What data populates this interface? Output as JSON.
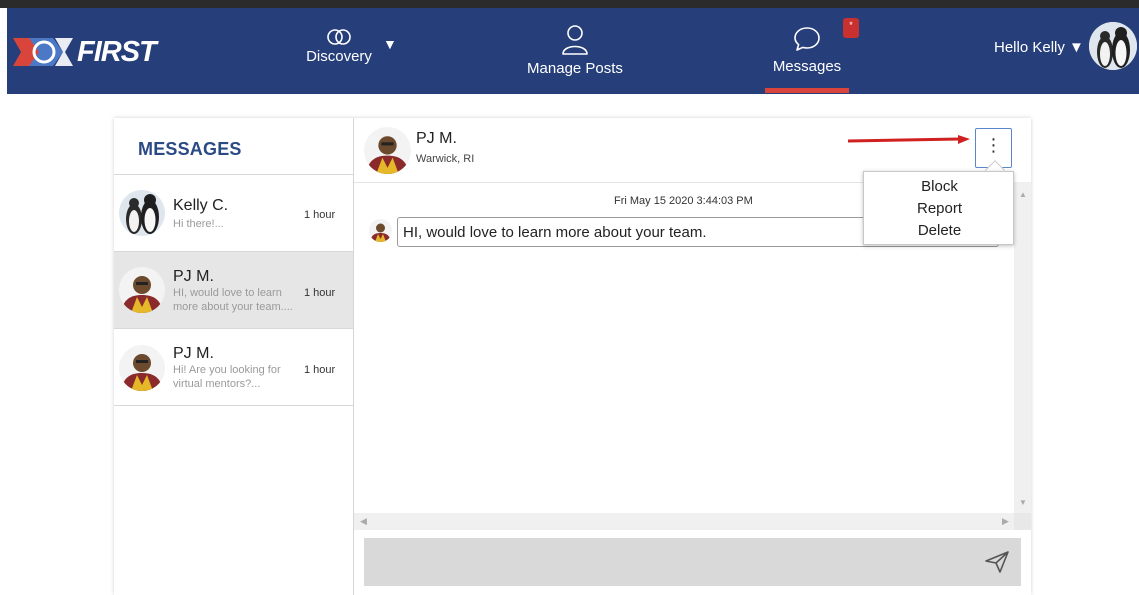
{
  "nav": {
    "logo_text": "FIRST",
    "discovery": "Discovery",
    "manage_posts": "Manage Posts",
    "messages": "Messages",
    "messages_badge": "*",
    "greeting": "Hello Kelly",
    "accent_color": "#263f7a",
    "active_underline_color": "#d9453a"
  },
  "sidebar": {
    "title": "MESSAGES",
    "conversations": [
      {
        "name": "Kelly C.",
        "preview": "Hi there!...",
        "time": "1 hour"
      },
      {
        "name": "PJ M.",
        "preview": "HI, would love to learn more about your team....",
        "time": "1 hour"
      },
      {
        "name": "PJ M.",
        "preview": "Hi! Are you looking for virtual mentors?...",
        "time": "1 hour"
      }
    ]
  },
  "chat": {
    "name": "PJ M.",
    "location": "Warwick, RI",
    "timestamp": "Fri May 15 2020 3:44:03 PM",
    "message": "HI, would love to learn more about your team.",
    "more_icon": "⋮"
  },
  "menu": {
    "items": [
      "Block",
      "Report",
      "Delete"
    ]
  }
}
